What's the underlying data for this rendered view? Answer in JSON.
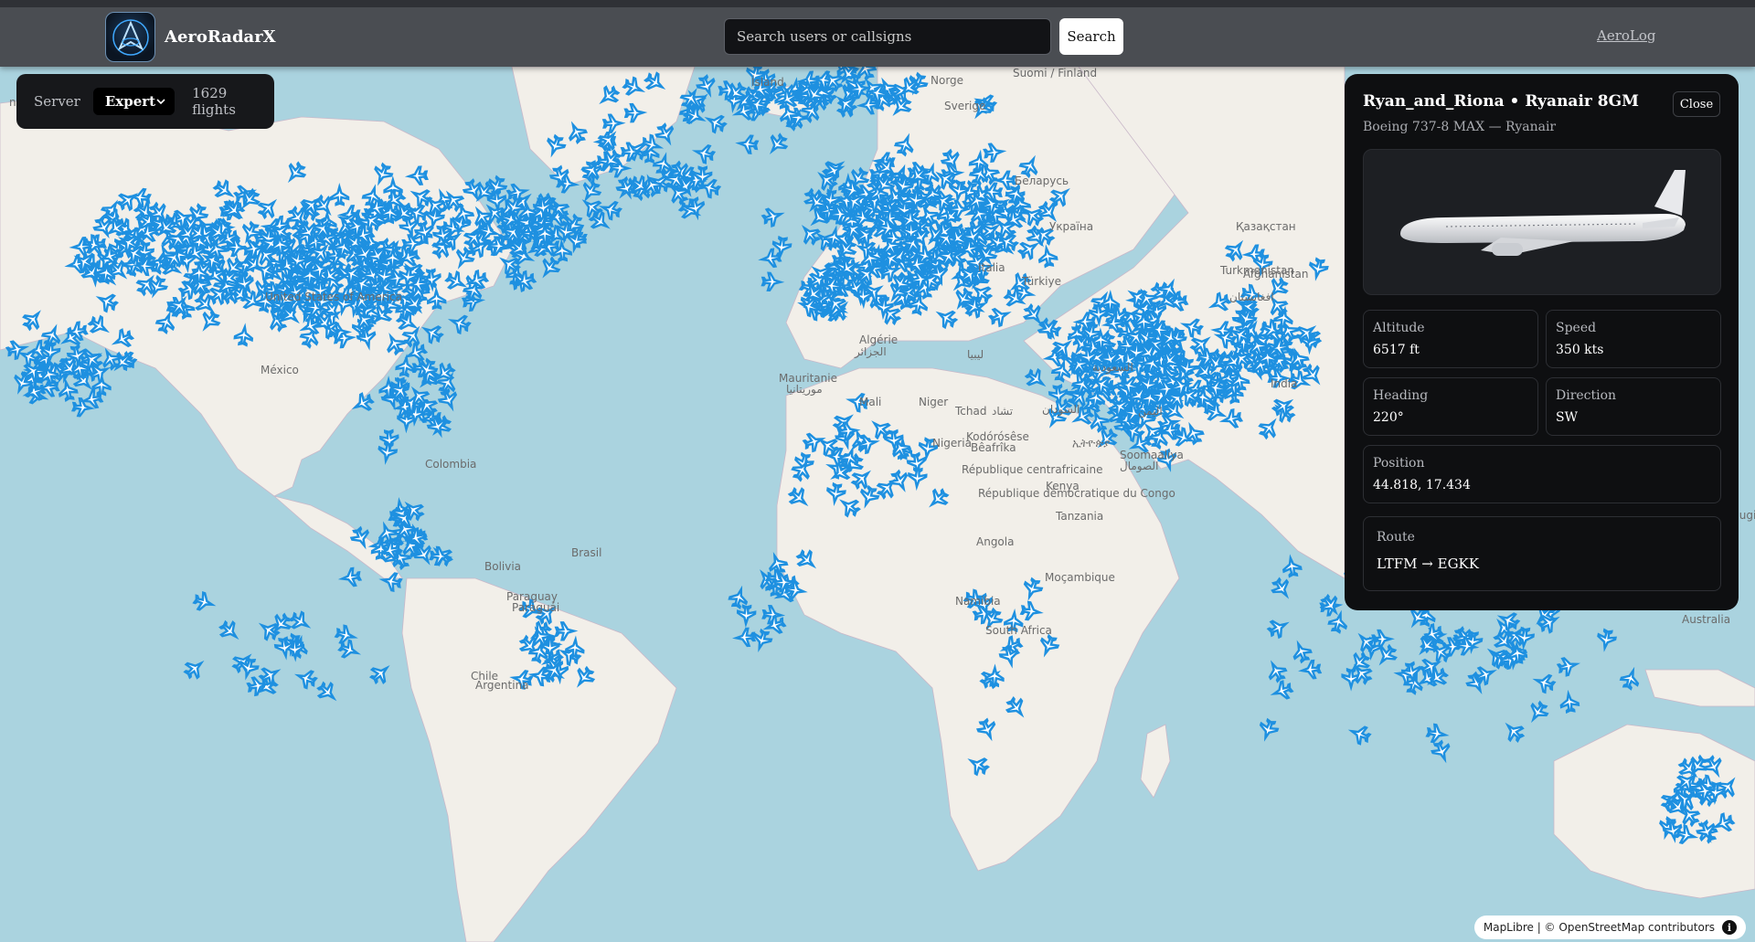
{
  "header": {
    "brand": "AeroRadarX",
    "search_placeholder": "Search users or callsigns",
    "search_button": "Search",
    "aerolog_link": "AeroLog"
  },
  "server_panel": {
    "label": "Server",
    "selected": "Expert",
    "flights": "1629 flights"
  },
  "flight": {
    "title": "Ryan_and_Riona • Ryanair 8GM",
    "subtitle": "Boeing 737-8 MAX — Ryanair",
    "close": "Close",
    "altitude_label": "Altitude",
    "altitude": "6517 ft",
    "speed_label": "Speed",
    "speed": "350 kts",
    "heading_label": "Heading",
    "heading": "220°",
    "direction_label": "Direction",
    "direction": "SW",
    "position_label": "Position",
    "position": "44.818, 17.434",
    "route_label": "Route",
    "route": "LTFM → EGKK"
  },
  "attribution": {
    "maplibre": "MapLibre",
    "osm": "| © OpenStreetMap contributors",
    "info": "i"
  },
  "map_labels": [
    "Ísland",
    "Norge",
    "Suomi / Finland",
    "Sverige",
    "Беларусь",
    "Україна",
    "Қазақстан",
    "nada",
    "United States of America",
    "México",
    "Algérie",
    "الجزائر",
    "ليبيا",
    "Mauritanie",
    "موريتانيا",
    "Mali",
    "Niger",
    "Tchad",
    "تشاد",
    "السودان",
    "Nigeria",
    "Kodórósêse",
    "Bêafrîka",
    "République centrafricaine",
    "République démocratique du Congo",
    "ኢትዮጵያ",
    "Soomaaliya",
    "الصومال",
    "Kenya",
    "Tanzania",
    "Angola",
    "Moçambique",
    "Namibia",
    "South Africa",
    "Colombia",
    "Brasil",
    "Bolivia",
    "Paraguay",
    "Paraguái",
    "Chile",
    "Argentina",
    "Türkiye",
    "السعودية",
    "اليمن",
    "Australia",
    "Papua Niugini",
    "Italia",
    "Afghanistan",
    "افغانستان",
    "Turkmenistan",
    "India"
  ],
  "colors": {
    "water": "#aad3df",
    "land": "#f2efe9",
    "aircraft": "#1e90e0",
    "header": "#4a4d52",
    "panel": "#0e0f11"
  }
}
